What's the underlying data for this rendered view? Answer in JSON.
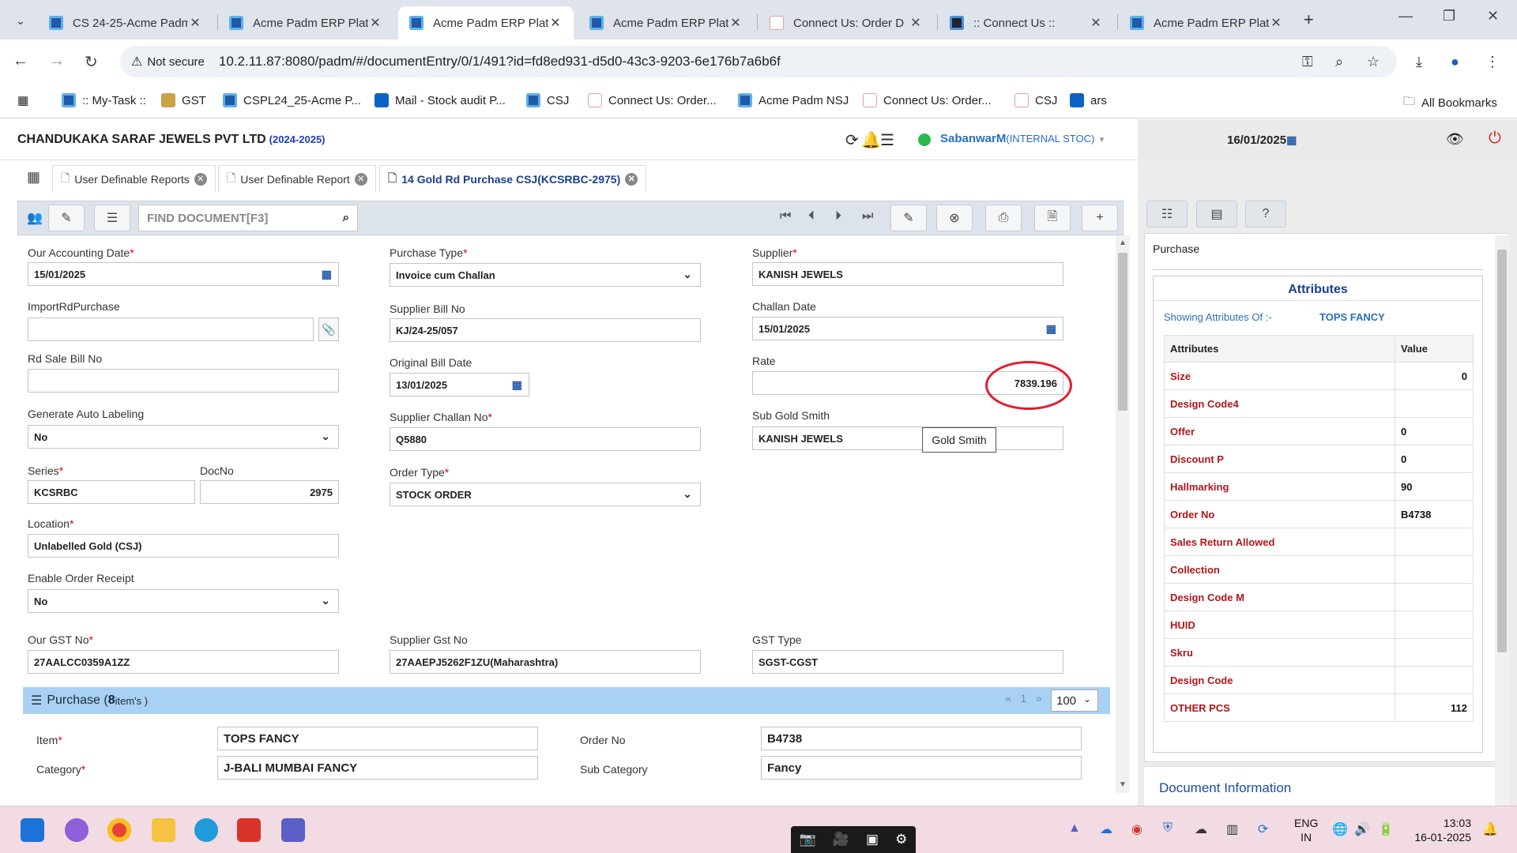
{
  "browser": {
    "tabs": [
      {
        "title": "CS 24-25-Acme Padm",
        "icon": "acme"
      },
      {
        "title": "Acme Padm ERP Platf",
        "icon": "acme"
      },
      {
        "title": "Acme Padm ERP Platf",
        "icon": "acme",
        "active": true
      },
      {
        "title": "Acme Padm ERP Platf",
        "icon": "acme"
      },
      {
        "title": "Connect Us: Order D",
        "icon": "connect"
      },
      {
        "title": ":: Connect Us ::",
        "icon": "connect-dark"
      },
      {
        "title": "Acme Padm ERP Platf",
        "icon": "acme"
      }
    ],
    "security_label": "Not secure",
    "url": "10.2.11.87:8080/padm/#/documentEntry/0/1/491?id=fd8ed931-d5d0-43c3-9203-6e176b7a6b6f",
    "bookmarks": [
      ":: My-Task ::",
      "GST",
      "CSPL24_25-Acme P...",
      "Mail - Stock audit P...",
      "CSJ",
      "Connect Us: Order...",
      "Acme Padm NSJ",
      "Connect Us: Order...",
      "CSJ",
      "ars"
    ],
    "all_bookmarks": "All Bookmarks"
  },
  "app": {
    "company": "CHANDUKAKA SARAF JEWELS PVT LTD",
    "year": "(2024-2025)",
    "user": "SabanwarM",
    "user_role": "(INTERNAL STOC)",
    "date": "16/01/2025"
  },
  "doc_tabs": [
    {
      "label": "User Definable Reports"
    },
    {
      "label": "User Definable Report"
    },
    {
      "label": "14 Gold Rd Purchase CSJ(KCSRBC-2975)",
      "active": true
    }
  ],
  "toolbar": {
    "find_placeholder": "FIND DOCUMENT[F3]"
  },
  "form": {
    "accounting_date_label": "Our Accounting Date",
    "accounting_date": "15/01/2025",
    "purchase_type_label": "Purchase Type",
    "purchase_type": "Invoice cum Challan",
    "supplier_label": "Supplier",
    "supplier": "KANISH JEWELS",
    "import_label": "ImportRdPurchase",
    "import_value": "",
    "supplier_bill_label": "Supplier Bill No",
    "supplier_bill": "KJ/24-25/057",
    "challan_date_label": "Challan Date",
    "challan_date": "15/01/2025",
    "rd_sale_label": "Rd Sale Bill No",
    "rd_sale_value": "",
    "orig_bill_date_label": "Original Bill Date",
    "orig_bill_date": "13/01/2025",
    "rate_label": "Rate",
    "rate": "7839.196",
    "auto_label_label": "Generate Auto Labeling",
    "auto_label": "No",
    "supplier_challan_label": "Supplier Challan No",
    "supplier_challan": "Q5880",
    "sub_gold_smith_label": "Sub Gold Smith",
    "sub_gold_smith": "KANISH JEWELS",
    "tooltip": "Gold Smith",
    "series_label": "Series",
    "series": "KCSRBC",
    "docno_label": "DocNo",
    "docno": "2975",
    "order_type_label": "Order Type",
    "order_type": "STOCK ORDER",
    "location_label": "Location",
    "location": "Unlabelled Gold (CSJ)",
    "order_receipt_label": "Enable Order Receipt",
    "order_receipt": "No",
    "our_gst_label": "Our GST No",
    "our_gst": "27AALCC0359A1ZZ",
    "supplier_gst_label": "Supplier Gst No",
    "supplier_gst": "27AAEPJ5262F1ZU(Maharashtra)",
    "gst_type_label": "GST Type",
    "gst_type": "SGST-CGST"
  },
  "purchase": {
    "title": "Purchase",
    "count_prefix": "( ",
    "count": "8",
    "count_suffix": " item's )",
    "page_prev": "«",
    "page": "1",
    "page_next": "»",
    "per_page": "100",
    "item_label": "Item",
    "item": "TOPS FANCY",
    "order_no_label": "Order No",
    "order_no": "B4738",
    "category_label": "Category",
    "category": "J-BALI MUMBAI FANCY",
    "sub_category_label": "Sub Category",
    "sub_category": "Fancy"
  },
  "right_panel": {
    "section": "Purchase",
    "attributes_title": "Attributes",
    "showing_label": "Showing Attributes Of :-",
    "showing_value": "TOPS FANCY",
    "col_attr": "Attributes",
    "col_value": "Value",
    "rows": [
      {
        "name": "Size",
        "value": "0",
        "align": "right"
      },
      {
        "name": "Design Code4",
        "value": ""
      },
      {
        "name": "Offer",
        "value": "0"
      },
      {
        "name": "Discount P",
        "value": "0"
      },
      {
        "name": "Hallmarking",
        "value": "90"
      },
      {
        "name": "Order No",
        "value": "B4738"
      },
      {
        "name": "Sales Return Allowed",
        "value": ""
      },
      {
        "name": "Collection",
        "value": ""
      },
      {
        "name": "Design Code M",
        "value": ""
      },
      {
        "name": "HUID",
        "value": ""
      },
      {
        "name": "Skru",
        "value": ""
      },
      {
        "name": "Design Code",
        "value": ""
      },
      {
        "name": "OTHER PCS",
        "value": "112",
        "align": "right"
      }
    ],
    "doc_info": "Document Information"
  },
  "taskbar": {
    "lang_top": "ENG",
    "lang_bottom": "IN",
    "time": "13:03",
    "date": "16-01-2025"
  }
}
